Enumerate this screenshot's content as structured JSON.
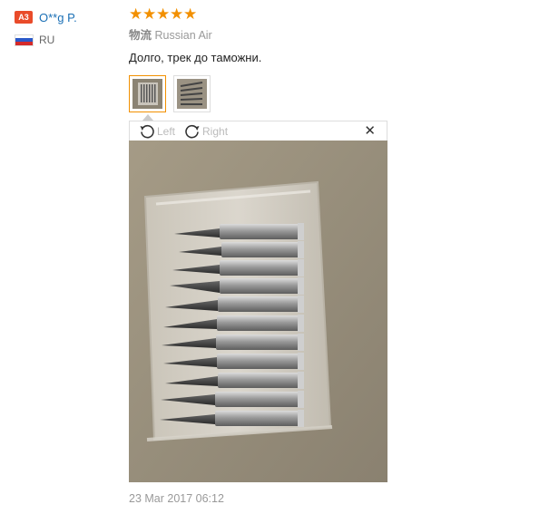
{
  "user": {
    "level": "A3",
    "name": "O**g P.",
    "country": "RU",
    "flag_colors": [
      "#ffffff",
      "#2a59c9",
      "#d42a2a"
    ]
  },
  "review": {
    "rating": 5,
    "stars": [
      "★",
      "★",
      "★",
      "★",
      "★"
    ],
    "shipping_label": "物流",
    "shipping_method": "Russian Air",
    "text": "Долго, трек до таможни.",
    "date": "23 Mar 2017 06:12"
  },
  "viewer": {
    "rotate_left_label": "Left",
    "rotate_right_label": "Right",
    "close_glyph": "✕"
  },
  "colors": {
    "accent": "#f29000",
    "link": "#1a6fb5",
    "badge": "#e94b2a"
  },
  "icons": [
    "rotate-left-icon",
    "rotate-right-icon",
    "close-icon",
    "star-icon"
  ]
}
